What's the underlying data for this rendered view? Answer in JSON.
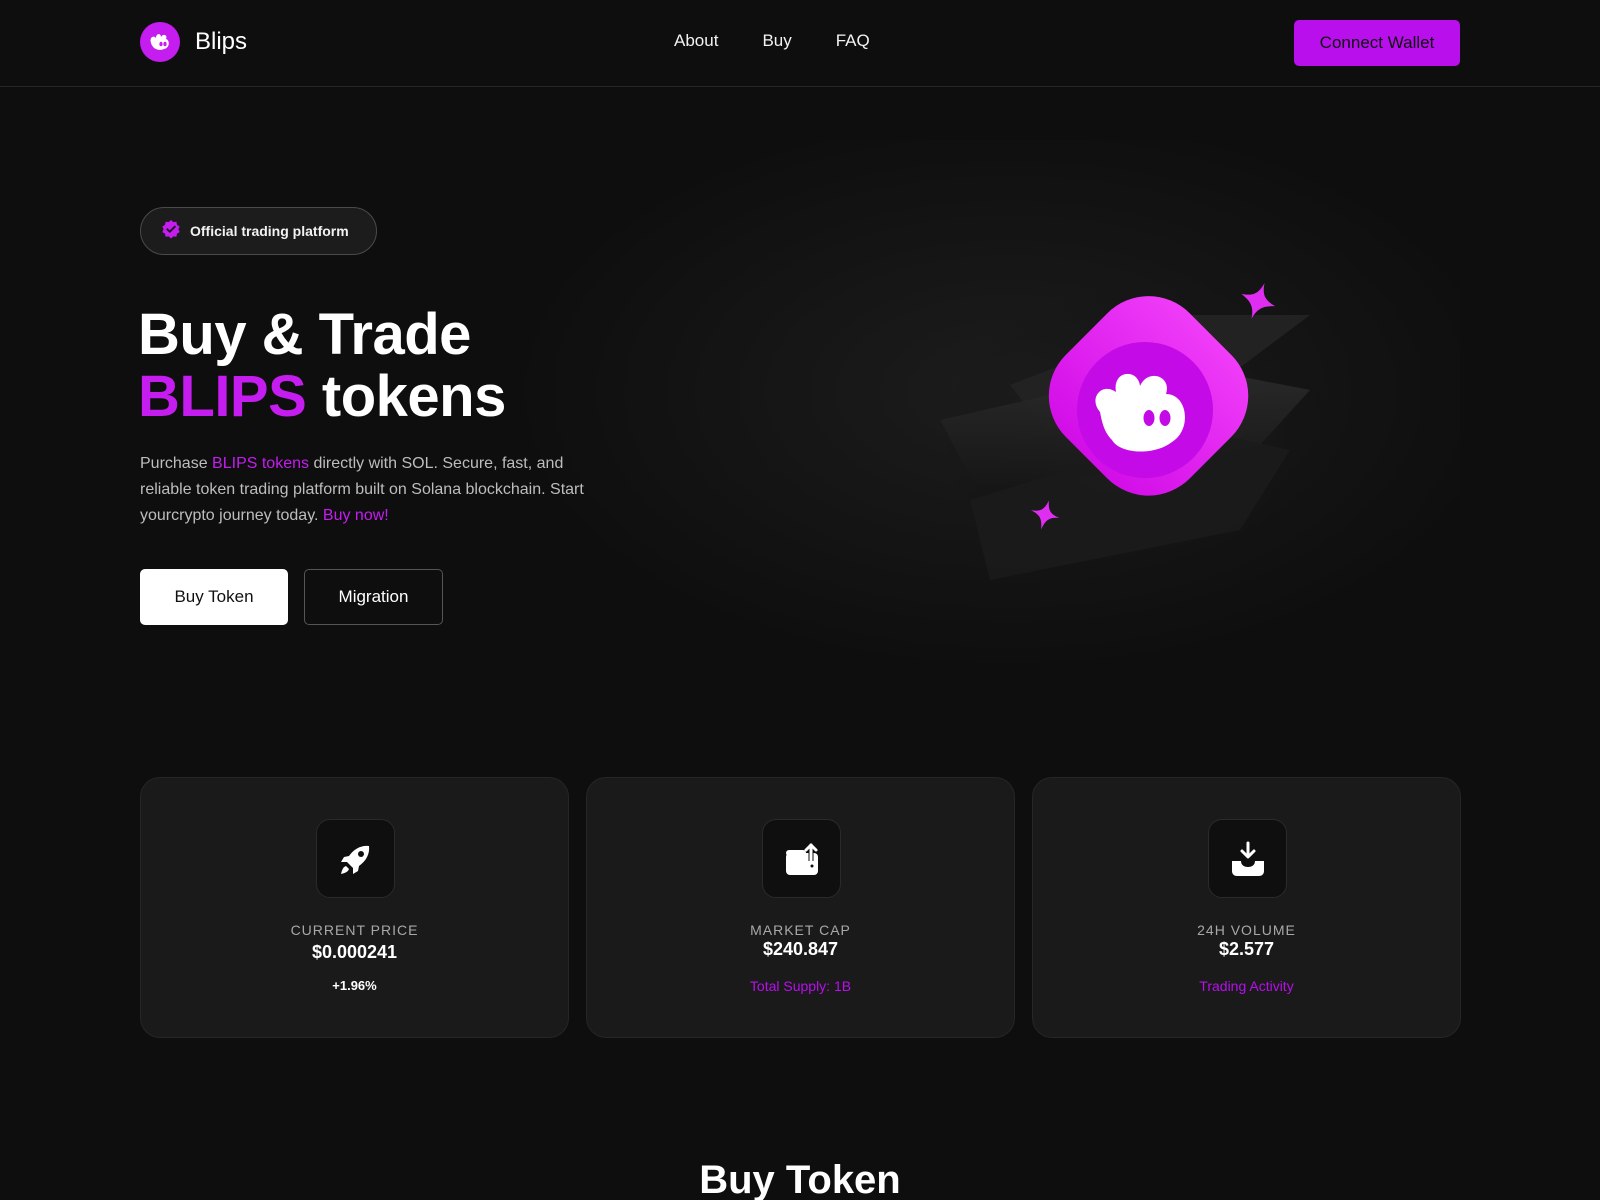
{
  "nav": {
    "brand": "Blips",
    "links": [
      "About",
      "Buy",
      "FAQ"
    ],
    "connect_label": "Connect Wallet"
  },
  "hero": {
    "badge": "Official trading platform",
    "title_line1": "Buy & Trade",
    "title_accent": "BLIPS",
    "title_rest": " tokens",
    "desc_prefix": "Purchase ",
    "desc_accent": "BLIPS tokens",
    "desc_body": " directly with SOL. Secure, fast, and reliable token trading platform built on Solana blockchain. Start yourcrypto journey today. ",
    "desc_cta": "Buy now!",
    "buy_button": "Buy Token",
    "migration_button": "Migration"
  },
  "stats": [
    {
      "icon": "rocket-icon",
      "label": "CURRENT PRICE",
      "value": "$0.000241",
      "sub": "+1.96%",
      "sub_color": "#ffffff"
    },
    {
      "icon": "wallet-upload-icon",
      "label": "MARKET CAP",
      "value": "$240.847",
      "sub": "Total Supply: 1B",
      "sub_color": "#b80fec"
    },
    {
      "icon": "inbox-download-icon",
      "label": "24H VOLUME",
      "value": "$2.577",
      "sub": "Trading Activity",
      "sub_color": "#b80fec"
    }
  ],
  "section_heading": "Buy Token",
  "colors": {
    "accent": "#c51cf0",
    "background": "#0e0e0e",
    "card": "#1a1a1a"
  }
}
